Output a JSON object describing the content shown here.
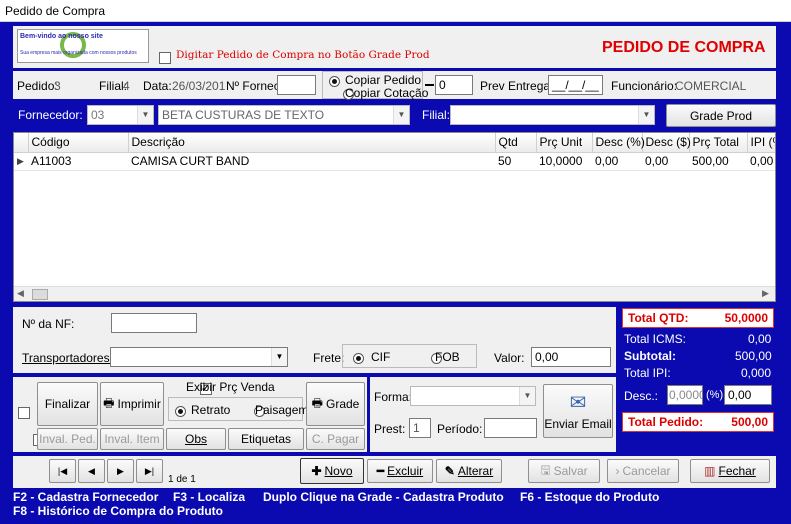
{
  "window": {
    "title": "Pedido de Compra"
  },
  "header": {
    "logo_text": "Bem-vindo ao nosso site",
    "logo_sub": "Sua empresa mais organizada com nossos produtos",
    "grade_check_label": "Digitar Pedido de Compra no Botão Grade Prod",
    "heading": "PEDIDO DE COMPRA"
  },
  "info": {
    "pedido_label": "Pedido:",
    "pedido_value": "3",
    "filial_label": "Filial:",
    "filial_value": "4",
    "data_label": "Data:",
    "data_value": "26/03/201",
    "nfornec_label": "Nº Fornec.",
    "nfornec_value": "",
    "copiar_pedido": "Copiar Pedido",
    "copiar_cotacao": "Copiar Cotação",
    "copy_number": "0",
    "prev_entrega_label": "Prev Entrega:",
    "prev_entrega_value": "__/__/__",
    "funcionario_label": "Funcionário:",
    "funcionario_value": "COMERCIAL"
  },
  "fornecedor": {
    "label": "Fornecedor:",
    "code": "03",
    "name": "BETA CUSTURAS DE TEXTO",
    "filial_label": "Filial:",
    "filial_value": "",
    "grade_button": "Grade Prod"
  },
  "table": {
    "columns": [
      "Código",
      "Descrição",
      "Qtd",
      "Prç Unit",
      "Desc (%)",
      "Desc ($)",
      "Prç Total",
      "IPI (%)"
    ],
    "rows": [
      [
        "A11003",
        "CAMISA CURT BAND",
        "50",
        "10,0000",
        "0,00",
        "0,00",
        "500,00",
        "0,00"
      ]
    ]
  },
  "nf": {
    "label": "Nº da NF:",
    "value": "",
    "transp_label": "Transportadores:",
    "transp_value": "",
    "frete_label": "Frete:",
    "cif": "CIF",
    "fob": "FOB",
    "valor_label": "Valor:",
    "valor_value": "0,00"
  },
  "totals": {
    "qtd_label": "Total QTD:",
    "qtd_value": "50,0000",
    "icms_label": "Total ICMS:",
    "icms_value": "0,00",
    "subtotal_label": "Subtotal:",
    "subtotal_value": "500,00",
    "ipi_label": "Total IPI:",
    "ipi_value": "0,000",
    "desc_label": "Desc.:",
    "desc_pct": "0,0000",
    "pct_sign": "(%)",
    "desc_value": "0,00",
    "pedido_label": "Total Pedido:",
    "pedido_value": "500,00"
  },
  "actions": {
    "finalizar": "Finalizar",
    "imprimir": "Imprimir",
    "exibir_prc": "Exibir Prç Venda",
    "retrato": "Retrato",
    "paisagem": "Paisagem",
    "grade": "Grade",
    "inval_ped": "Inval. Ped.",
    "inval_item": "Inval. Item",
    "obs": "Obs",
    "etiquetas": "Etiquetas",
    "c_pagar": "C. Pagar",
    "forma_label": "Forma:",
    "forma_value": "",
    "prest_label": "Prest:",
    "prest_value": "1",
    "periodo_label": "Período:",
    "periodo_value": "",
    "enviar_email": "Enviar Email"
  },
  "nav": {
    "record_info": "1 de 1",
    "novo": "Novo",
    "excluir": "Excluir",
    "alterar": "Alterar",
    "salvar": "Salvar",
    "cancelar": "Cancelar",
    "fechar": "Fechar"
  },
  "shortcuts": {
    "f2": "F2 - Cadastra Fornecedor",
    "f3": "F3 - Localiza",
    "duplo": "Duplo Clique na Grade - Cadastra Produto",
    "f6": "F6 - Estoque do Produto",
    "f8": "F8 - Histórico de Compra do Produto"
  },
  "colors": {
    "frame": "#0a0ab0",
    "heading_red": "#e00000"
  }
}
